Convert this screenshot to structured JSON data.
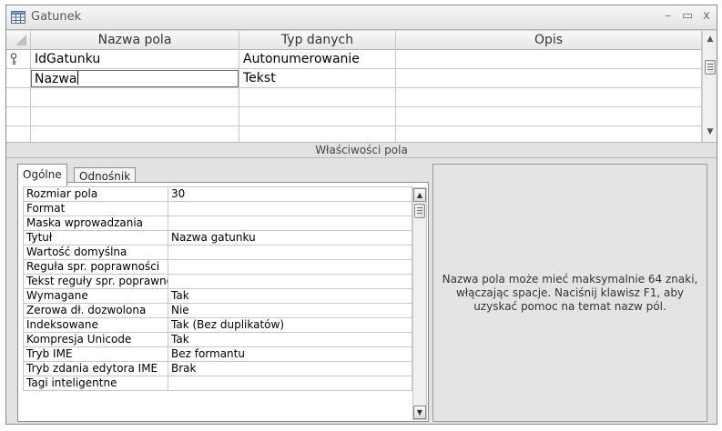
{
  "window": {
    "title": "Gatunek",
    "icon": "table-icon",
    "minimize_glyph": "–",
    "restore_glyph": "▭",
    "close_glyph": "x"
  },
  "design_grid": {
    "columns": [
      "Nazwa pola",
      "Typ danych",
      "Opis"
    ],
    "rows": [
      {
        "name": "IdGatunku",
        "type": "Autonumerowanie",
        "description": "",
        "primary_key": true
      },
      {
        "name": "Nazwa",
        "type": "Tekst",
        "description": "",
        "primary_key": false,
        "editing": true
      },
      {
        "name": "",
        "type": "",
        "description": ""
      },
      {
        "name": "",
        "type": "",
        "description": ""
      },
      {
        "name": "",
        "type": "",
        "description": ""
      }
    ]
  },
  "section_label": "Właściwości pola",
  "tabs": [
    {
      "label": "Ogólne",
      "active": true
    },
    {
      "label": "Odnośnik",
      "active": false
    }
  ],
  "properties": [
    {
      "key": "Rozmiar pola",
      "value": "30"
    },
    {
      "key": "Format",
      "value": ""
    },
    {
      "key": "Maska wprowadzania",
      "value": ""
    },
    {
      "key": "Tytuł",
      "value": "Nazwa gatunku"
    },
    {
      "key": "Wartość domyślna",
      "value": ""
    },
    {
      "key": "Reguła spr. poprawności",
      "value": ""
    },
    {
      "key": "Tekst reguły spr. poprawności",
      "value": ""
    },
    {
      "key": "Wymagane",
      "value": "Tak"
    },
    {
      "key": "Zerowa dł. dozwolona",
      "value": "Nie"
    },
    {
      "key": "Indeksowane",
      "value": "Tak (Bez duplikatów)"
    },
    {
      "key": "Kompresja Unicode",
      "value": "Tak"
    },
    {
      "key": "Tryb IME",
      "value": "Bez formantu"
    },
    {
      "key": "Tryb zdania edytora IME",
      "value": "Brak"
    },
    {
      "key": "Tagi inteligentne",
      "value": ""
    }
  ],
  "help_text": "Nazwa pola może mieć maksymalnie 64 znaki, włączając spacje. Naciśnij klawisz F1, aby uzyskać pomoc na temat nazw pól."
}
